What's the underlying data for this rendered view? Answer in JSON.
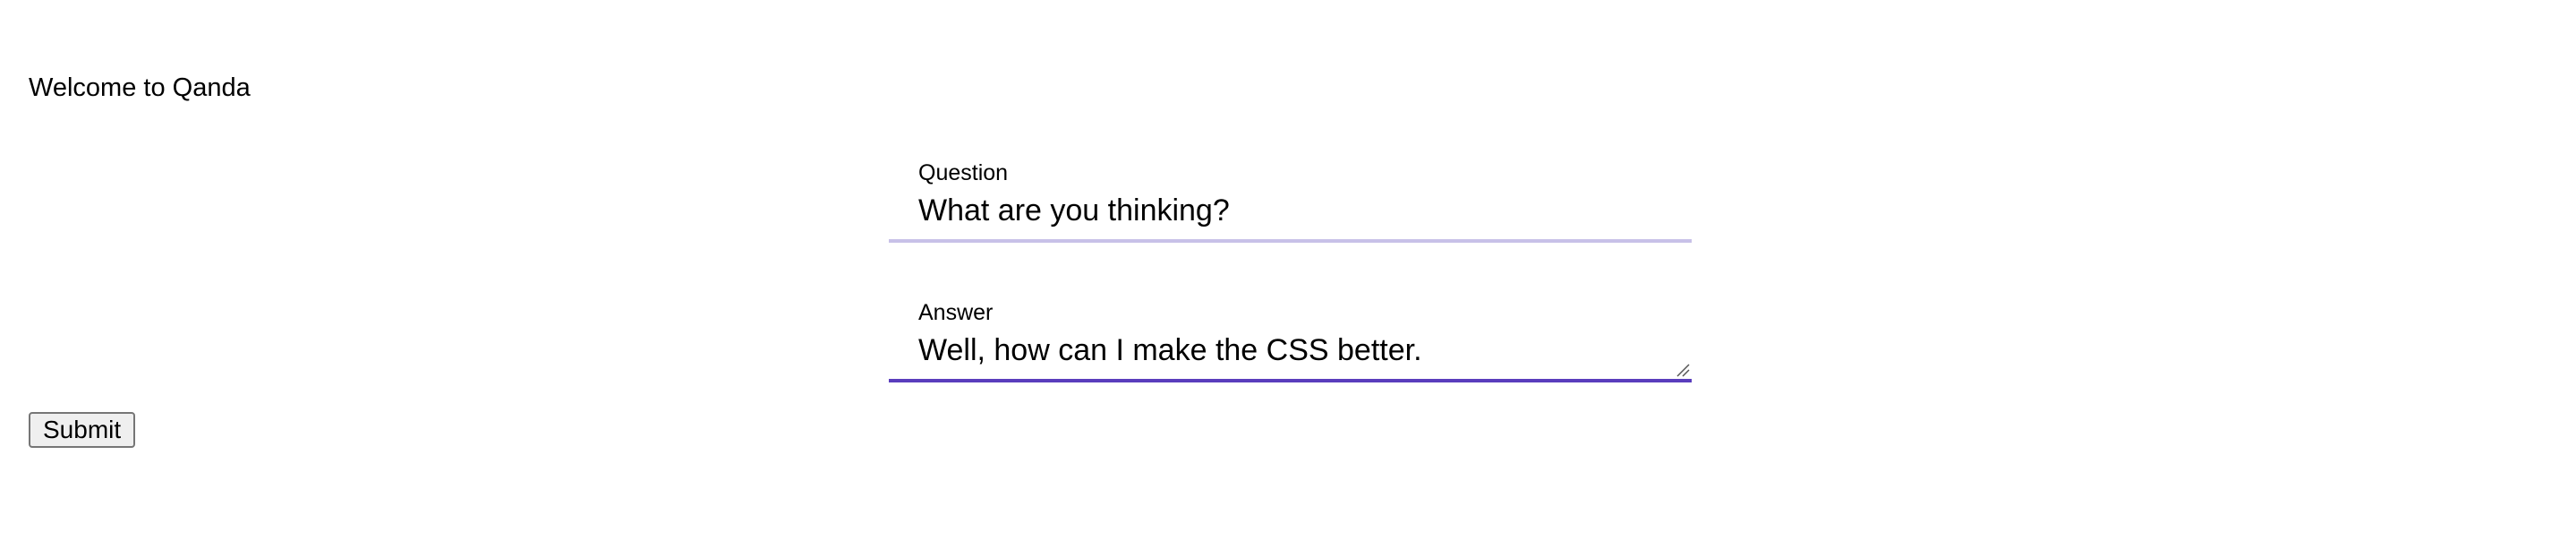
{
  "header": {
    "welcome_text": "Welcome to Qanda"
  },
  "form": {
    "question": {
      "label": "Question",
      "value": "What are you thinking?"
    },
    "answer": {
      "label": "Answer",
      "value": "Well, how can I make the CSS better."
    },
    "submit_label": "Submit"
  },
  "colors": {
    "question_underline": "#c8c1e8",
    "answer_underline": "#5a3dbd",
    "button_background": "#efefef",
    "button_border": "#767676"
  },
  "icons": {
    "resize_grip": "resize-grip-icon"
  }
}
